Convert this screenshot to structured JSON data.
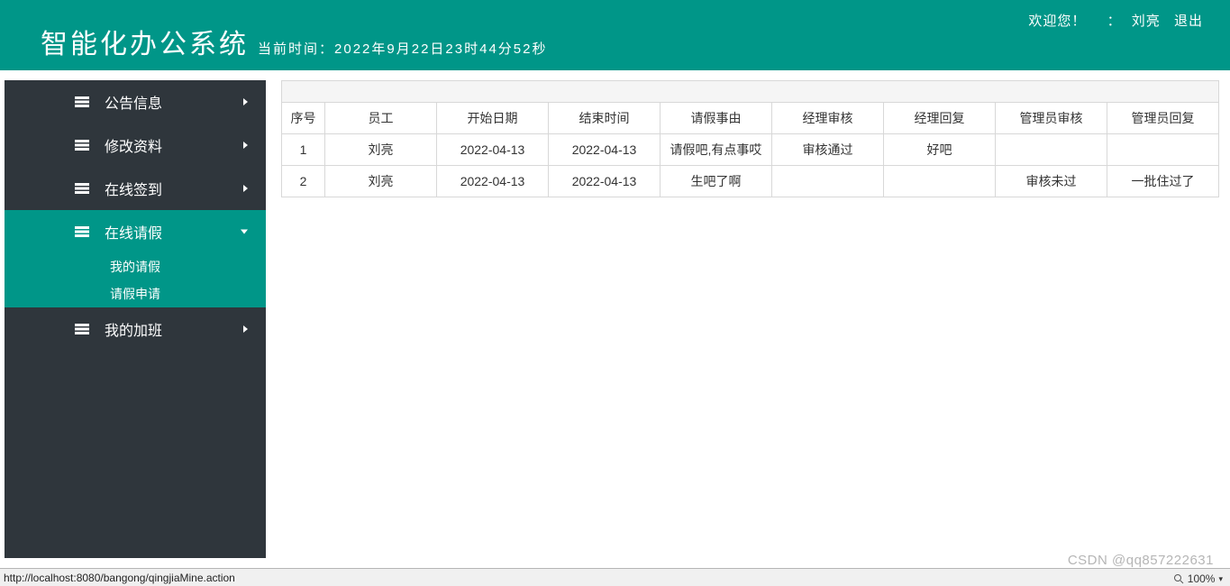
{
  "header": {
    "title": "智能化办公系统",
    "subtitle_prefix": "当前时间：",
    "subtitle_time": "2022年9月22日23时44分52秒",
    "top": {
      "welcome": "欢迎您！",
      "colon": "：",
      "username": "刘亮",
      "logout": "退出"
    }
  },
  "sidebar": {
    "items": [
      {
        "label": "公告信息",
        "icon": "bars-icon",
        "expanded": false,
        "active": false
      },
      {
        "label": "修改资料",
        "icon": "bars-icon",
        "expanded": false,
        "active": false
      },
      {
        "label": "在线签到",
        "icon": "bars-icon",
        "expanded": false,
        "active": false
      },
      {
        "label": "在线请假",
        "icon": "bars-icon",
        "expanded": true,
        "active": true,
        "children": [
          {
            "label": "我的请假"
          },
          {
            "label": "请假申请"
          }
        ]
      },
      {
        "label": "我的加班",
        "icon": "bars-icon",
        "expanded": false,
        "active": false
      }
    ]
  },
  "table": {
    "headers": [
      "序号",
      "员工",
      "开始日期",
      "结束时间",
      "请假事由",
      "经理审核",
      "经理回复",
      "管理员审核",
      "管理员回复"
    ],
    "rows": [
      [
        "1",
        "刘亮",
        "2022-04-13",
        "2022-04-13",
        "请假吧,有点事哎",
        "审核通过",
        "好吧",
        "",
        ""
      ],
      [
        "2",
        "刘亮",
        "2022-04-13",
        "2022-04-13",
        "生吧了啊",
        "",
        "",
        "审核未过",
        "一批住过了"
      ]
    ]
  },
  "status_bar": {
    "url": "http://localhost:8080/bangong/qingjiaMine.action",
    "zoom": "100%"
  },
  "watermark": "CSDN @qq857222631"
}
